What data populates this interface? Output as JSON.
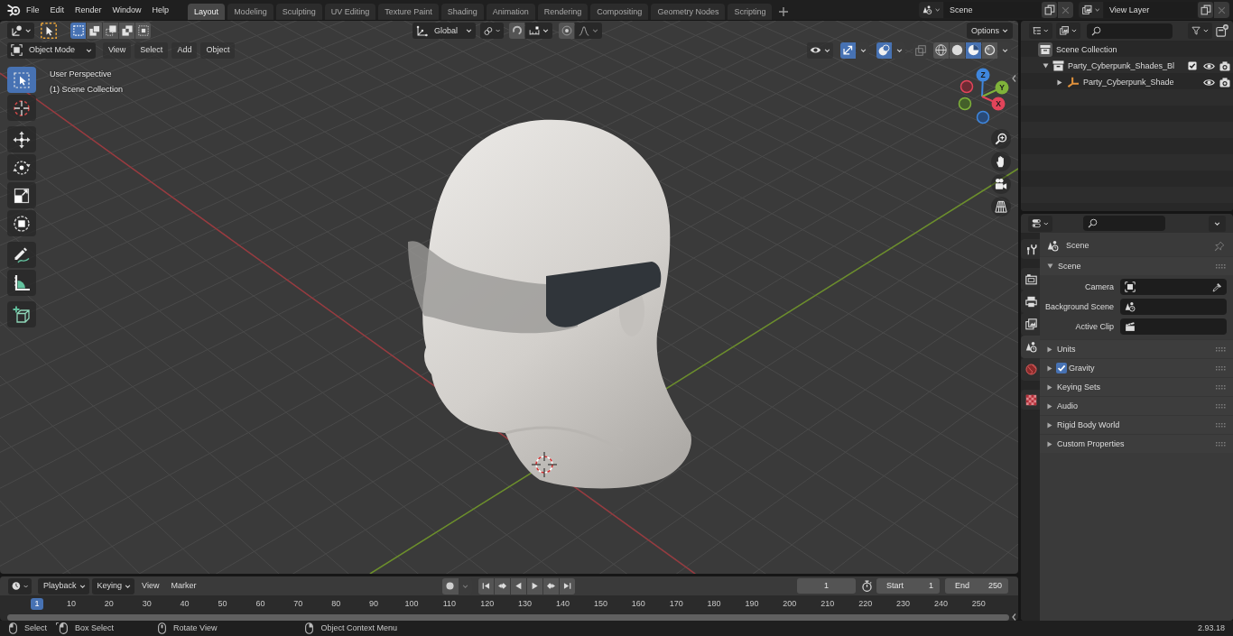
{
  "topbar": {
    "menus": [
      "File",
      "Edit",
      "Render",
      "Window",
      "Help"
    ],
    "workspaces": [
      {
        "label": "Layout",
        "selected": true
      },
      {
        "label": "Modeling",
        "selected": false
      },
      {
        "label": "Sculpting",
        "selected": false
      },
      {
        "label": "UV Editing",
        "selected": false
      },
      {
        "label": "Texture Paint",
        "selected": false
      },
      {
        "label": "Shading",
        "selected": false
      },
      {
        "label": "Animation",
        "selected": false
      },
      {
        "label": "Rendering",
        "selected": false
      },
      {
        "label": "Compositing",
        "selected": false
      },
      {
        "label": "Geometry Nodes",
        "selected": false
      },
      {
        "label": "Scripting",
        "selected": false
      }
    ],
    "scene": "Scene",
    "view_layer": "View Layer"
  },
  "viewport": {
    "select_modes": [
      {
        "selected": true
      },
      {
        "selected": false
      },
      {
        "selected": false
      },
      {
        "selected": false
      },
      {
        "selected": false
      }
    ],
    "orientation": "Global",
    "snapping": {
      "on": false
    },
    "proportional_editing": {
      "on": false
    },
    "options": "Options",
    "mode": "Object Mode",
    "menus": [
      "View",
      "Select",
      "Add",
      "Object"
    ],
    "gizmos": {
      "on": true
    },
    "overlays": {
      "on": true
    },
    "xray": {
      "on": false
    },
    "shading": [
      {
        "selected": false
      },
      {
        "selected": false
      },
      {
        "selected": true
      },
      {
        "selected": false
      }
    ],
    "tool_groups": [
      [
        {
          "selected": true
        },
        {
          "selected": false
        }
      ],
      [
        {
          "selected": false
        },
        {
          "selected": false
        },
        {
          "selected": false
        },
        {
          "selected": false
        }
      ],
      [
        {
          "selected": false
        },
        {
          "selected": false
        }
      ],
      [
        {
          "selected": false
        }
      ]
    ],
    "view_name": "User Perspective",
    "collection_label": "(1) Scene Collection",
    "axes": [
      "Z",
      "Y",
      "X"
    ]
  },
  "outliner": {
    "tree": [
      {
        "label": "Scene Collection",
        "kind": "root",
        "children": [
          {
            "label": "Party_Cyberpunk_Shades_Bl",
            "kind": "collection",
            "expanded": true,
            "checked": true,
            "children": [
              {
                "label": "Party_Cyberpunk_Shade",
                "kind": "object",
                "expanded": false
              }
            ]
          }
        ]
      }
    ]
  },
  "properties": {
    "tabs": [
      [
        {
          "selected": false
        }
      ],
      [
        {
          "selected": false
        },
        {
          "selected": false
        },
        {
          "selected": false
        },
        {
          "selected": true
        },
        {
          "selected": false
        }
      ],
      [
        {
          "selected": false
        }
      ]
    ],
    "context": "Scene",
    "panels": [
      {
        "title": "Scene",
        "expanded": true,
        "fields": [
          {
            "label": "Camera",
            "kind": "object"
          },
          {
            "label": "Background Scene",
            "kind": "scene"
          },
          {
            "label": "Active Clip",
            "kind": "clip"
          }
        ]
      },
      {
        "title": "Units",
        "expanded": false
      },
      {
        "title": "Gravity",
        "expanded": false,
        "checked": true
      },
      {
        "title": "Keying Sets",
        "expanded": false
      },
      {
        "title": "Audio",
        "expanded": false
      },
      {
        "title": "Rigid Body World",
        "expanded": false
      },
      {
        "title": "Custom Properties",
        "expanded": false
      }
    ]
  },
  "timeline": {
    "menus": [
      {
        "label": "Playback",
        "kind": "dropdown"
      },
      {
        "label": "Keying",
        "kind": "dropdown"
      },
      {
        "label": "View",
        "kind": "menu"
      },
      {
        "label": "Marker",
        "kind": "menu"
      }
    ],
    "auto_keying": {
      "on": false
    },
    "current_frame": "1",
    "start": {
      "label": "Start",
      "value": "1"
    },
    "end": {
      "label": "End",
      "value": "250"
    },
    "frames": [
      {
        "label": "1",
        "selected": true
      },
      {
        "label": "10",
        "selected": false
      },
      {
        "label": "20",
        "selected": false
      },
      {
        "label": "30",
        "selected": false
      },
      {
        "label": "40",
        "selected": false
      },
      {
        "label": "50",
        "selected": false
      },
      {
        "label": "60",
        "selected": false
      },
      {
        "label": "70",
        "selected": false
      },
      {
        "label": "80",
        "selected": false
      },
      {
        "label": "90",
        "selected": false
      },
      {
        "label": "100",
        "selected": false
      },
      {
        "label": "110",
        "selected": false
      },
      {
        "label": "120",
        "selected": false
      },
      {
        "label": "130",
        "selected": false
      },
      {
        "label": "140",
        "selected": false
      },
      {
        "label": "150",
        "selected": false
      },
      {
        "label": "160",
        "selected": false
      },
      {
        "label": "170",
        "selected": false
      },
      {
        "label": "180",
        "selected": false
      },
      {
        "label": "190",
        "selected": false
      },
      {
        "label": "200",
        "selected": false
      },
      {
        "label": "210",
        "selected": false
      },
      {
        "label": "220",
        "selected": false
      },
      {
        "label": "230",
        "selected": false
      },
      {
        "label": "240",
        "selected": false
      },
      {
        "label": "250",
        "selected": false
      }
    ]
  },
  "status_bar": {
    "hints": [
      {
        "label": "Select",
        "kind": "click"
      },
      {
        "label": "Box Select",
        "kind": "drag"
      },
      {
        "label": "Rotate View",
        "kind": "middle"
      },
      {
        "label": "Object Context Menu",
        "kind": "right"
      }
    ],
    "version": "2.93.18"
  }
}
